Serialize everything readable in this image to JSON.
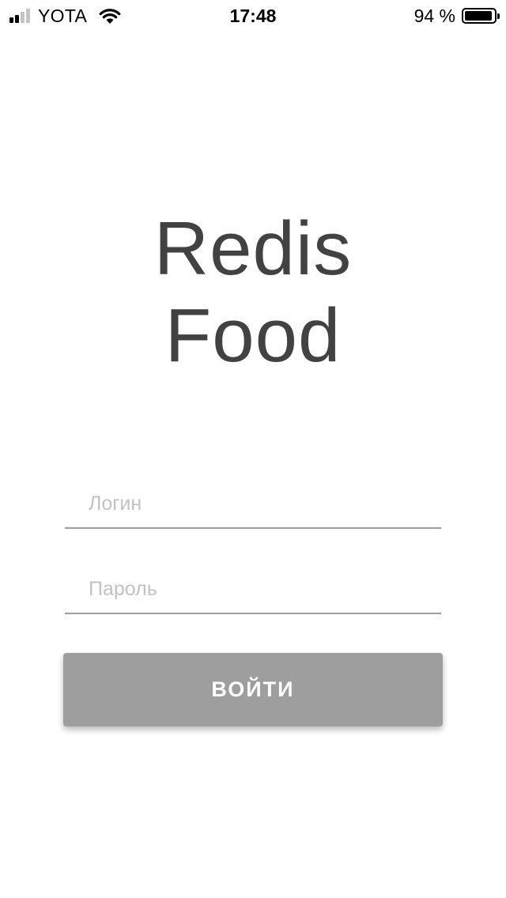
{
  "status_bar": {
    "carrier": "YOTA",
    "time": "17:48",
    "battery_percent": "94 %",
    "battery_level": 0.94,
    "signal_bars_active": 2,
    "signal_bars_total": 4,
    "icons": [
      "signal-icon",
      "wifi-icon",
      "battery-icon"
    ]
  },
  "app": {
    "title_line1": "Redis",
    "title_line2": "Food"
  },
  "form": {
    "login_placeholder": "Логин",
    "login_value": "",
    "password_placeholder": "Пароль",
    "password_value": "",
    "submit_label": "ВОЙТИ"
  },
  "colors": {
    "title": "#424242",
    "underline": "#9e9e9e",
    "placeholder": "#c2c2c2",
    "button_bg": "#9e9e9e",
    "button_text": "#ffffff"
  }
}
